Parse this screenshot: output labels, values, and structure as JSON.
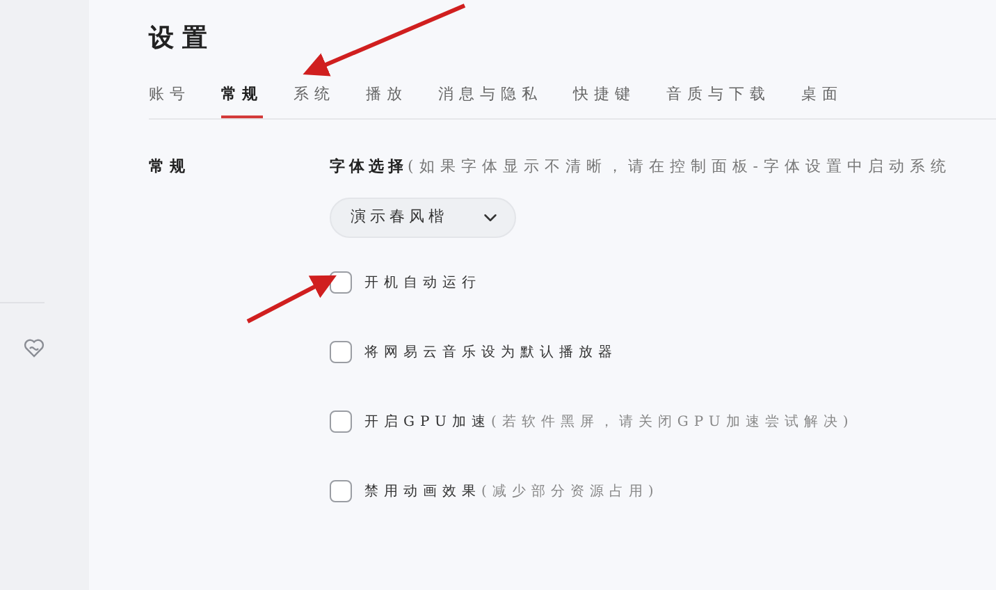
{
  "title": "设置",
  "tabs": [
    {
      "label": "账号",
      "selected": false
    },
    {
      "label": "常规",
      "selected": true
    },
    {
      "label": "系统",
      "selected": false
    },
    {
      "label": "播放",
      "selected": false
    },
    {
      "label": "消息与隐私",
      "selected": false
    },
    {
      "label": "快捷键",
      "selected": false
    },
    {
      "label": "音质与下载",
      "selected": false
    },
    {
      "label": "桌面",
      "selected": false
    }
  ],
  "section": "常规",
  "font_select": {
    "label": "字体选择",
    "hint": "(如果字体显示不清晰，请在控制面板-字体设置中启动系统",
    "value": "演示春风楷"
  },
  "options": [
    {
      "label": "开机自动运行",
      "checked": false
    },
    {
      "label": "将网易云音乐设为默认播放器",
      "checked": false
    },
    {
      "label": "开启GPU加速",
      "hint": "(若软件黑屏，请关闭GPU加速尝试解决)",
      "checked": false
    },
    {
      "label": "禁用动画效果",
      "hint": "(减少部分资源占用)",
      "checked": false
    }
  ]
}
